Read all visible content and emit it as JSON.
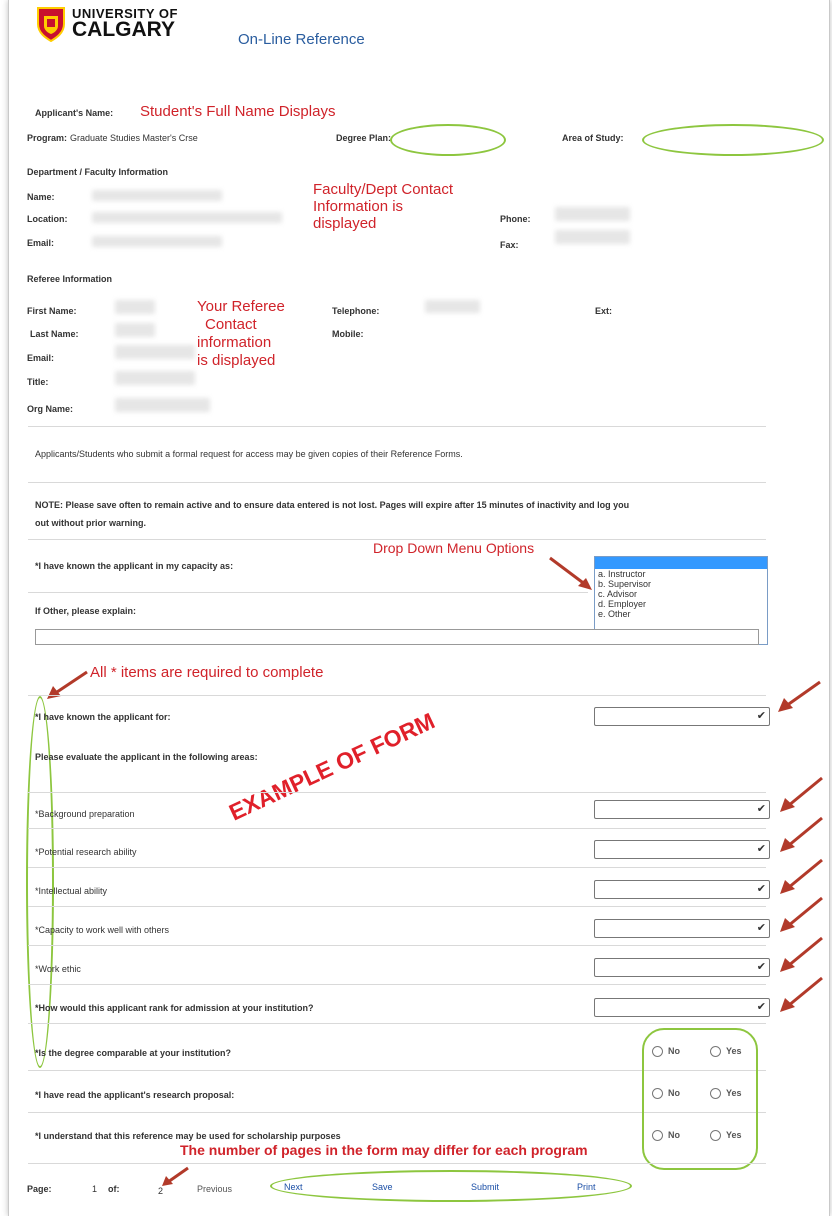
{
  "header": {
    "logo_line1": "UNIVERSITY OF",
    "logo_line2": "CALGARY",
    "page_title": "On-Line Reference"
  },
  "applicant": {
    "name_label": "Applicant's Name:",
    "name_note": "Student's Full Name Displays",
    "program_label": "Program:",
    "program_value": "Graduate Studies Master's Crse",
    "degree_plan_label": "Degree Plan:",
    "area_label": "Area of Study:"
  },
  "department": {
    "section_title": "Department / Faculty Information",
    "name_label": "Name:",
    "location_label": "Location:",
    "email_label": "Email:",
    "phone_label": "Phone:",
    "fax_label": "Fax:",
    "note_line1": "Faculty/Dept Contact",
    "note_line2": "Information  is",
    "note_line3": "displayed"
  },
  "referee": {
    "section_title": "Referee Information",
    "first_name_label": "First Name:",
    "last_name_label": "Last Name:",
    "email_label": "Email:",
    "title_label": "Title:",
    "org_label": "Org Name:",
    "telephone_label": "Telephone:",
    "mobile_label": "Mobile:",
    "ext_label": "Ext:",
    "note_line1": "Your Referee",
    "note_line2": "Contact",
    "note_line3": "information",
    "note_line4": "is displayed"
  },
  "notices": {
    "access_note": "Applicants/Students who submit a formal request for access may be given copies of their Reference Forms.",
    "save_note_line1": "NOTE: Please save often to remain active and to ensure data entered is not lost. Pages will expire after 15 minutes of inactivity and log you",
    "save_note_line2": "out without prior warning."
  },
  "capacity": {
    "question": "*I have known the applicant in my capacity as:",
    "other_label": "If Other, please explain:",
    "dropdown_note": "Drop Down Menu Options",
    "options": [
      "",
      "a. Instructor",
      "b. Supervisor",
      "c. Advisor",
      "d. Employer",
      "e. Other"
    ]
  },
  "annotations": {
    "required_note": "All * items are required to complete",
    "example_stamp": "EXAMPLE OF FORM",
    "pages_note": "The number of pages in the form may differ for each program"
  },
  "questions": {
    "known_for": "*I have known the applicant for:",
    "evaluate_heading": "Please evaluate the applicant in the following areas:",
    "background": "*Background preparation",
    "research": "*Potential research ability",
    "intellectual": "*Intellectual ability",
    "capacity_work": "*Capacity to work well with others",
    "work_ethic": "*Work ethic",
    "rank": "*How would this applicant rank for admission at your institution?",
    "degree_comparable": "*Is the degree comparable at your institution?",
    "read_proposal": "*I have read the applicant's research proposal:",
    "scholarship": "*I understand that this reference may be used for scholarship purposes",
    "no_label": "No",
    "yes_label": "Yes"
  },
  "pager": {
    "page_label": "Page:",
    "current_page": "1",
    "of_label": "of:",
    "total_pages": "2",
    "previous": "Previous",
    "next": "Next",
    "save": "Save",
    "submit": "Submit",
    "print": "Print"
  },
  "colors": {
    "annotation_red": "#d0232a",
    "highlight_green": "#8dc63f",
    "link_blue": "#1b4fa6",
    "title_blue": "#2a5d9f"
  }
}
